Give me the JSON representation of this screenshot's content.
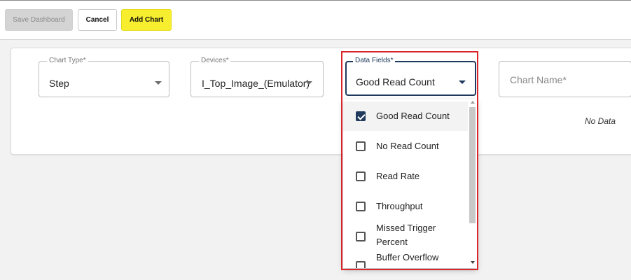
{
  "toolbar": {
    "save_label": "Save Dashboard",
    "cancel_label": "Cancel",
    "add_chart_label": "Add Chart"
  },
  "form": {
    "chart_type": {
      "label": "Chart Type*",
      "value": "Step"
    },
    "devices": {
      "label": "Devices*",
      "value": "I_Top_Image_(Emulator)"
    },
    "data_fields": {
      "label": "Data Fields*",
      "value": "Good Read Count"
    },
    "chart_name": {
      "placeholder": "Chart Name*"
    }
  },
  "preview": {
    "empty_text": "No Data"
  },
  "data_fields_menu": {
    "items": [
      {
        "label": "Good Read Count",
        "checked": true
      },
      {
        "label": "No Read Count",
        "checked": false
      },
      {
        "label": "Read Rate",
        "checked": false
      },
      {
        "label": "Throughput",
        "checked": false
      },
      {
        "label": "Missed Trigger",
        "label2": "Percent",
        "checked": false
      },
      {
        "label": "Buffer Overflow",
        "checked": false
      }
    ]
  },
  "colors": {
    "accent": "#1f3a5c",
    "add_button": "#f6ee2e",
    "highlight": "#d9262b"
  },
  "icons": {
    "dropdown": "caret-down-icon",
    "checkbox": "checkbox-icon"
  }
}
